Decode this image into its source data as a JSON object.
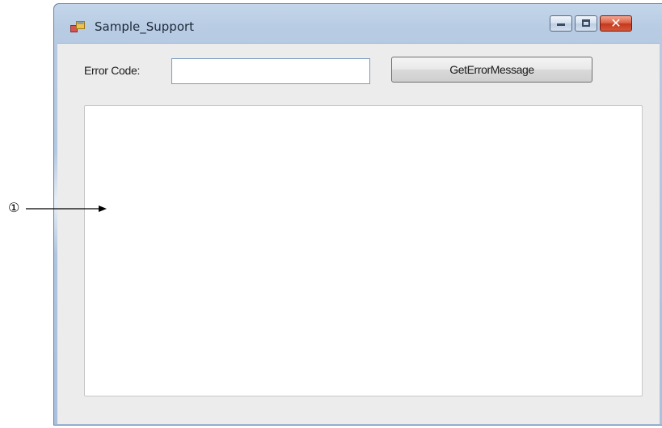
{
  "window": {
    "title": "Sample_Support",
    "controls": [
      "minimize-icon",
      "maximize-icon",
      "close-icon"
    ],
    "close_glyph": "✕"
  },
  "form": {
    "error_code_label": "Error Code:",
    "error_code_value": "",
    "button_label": "GetErrorMessage",
    "output_text": ""
  },
  "annotation": {
    "number": "①"
  },
  "colors": {
    "title_bar": "#b7cbe3",
    "client_background": "#ececec",
    "close_button": "#c3381c"
  }
}
